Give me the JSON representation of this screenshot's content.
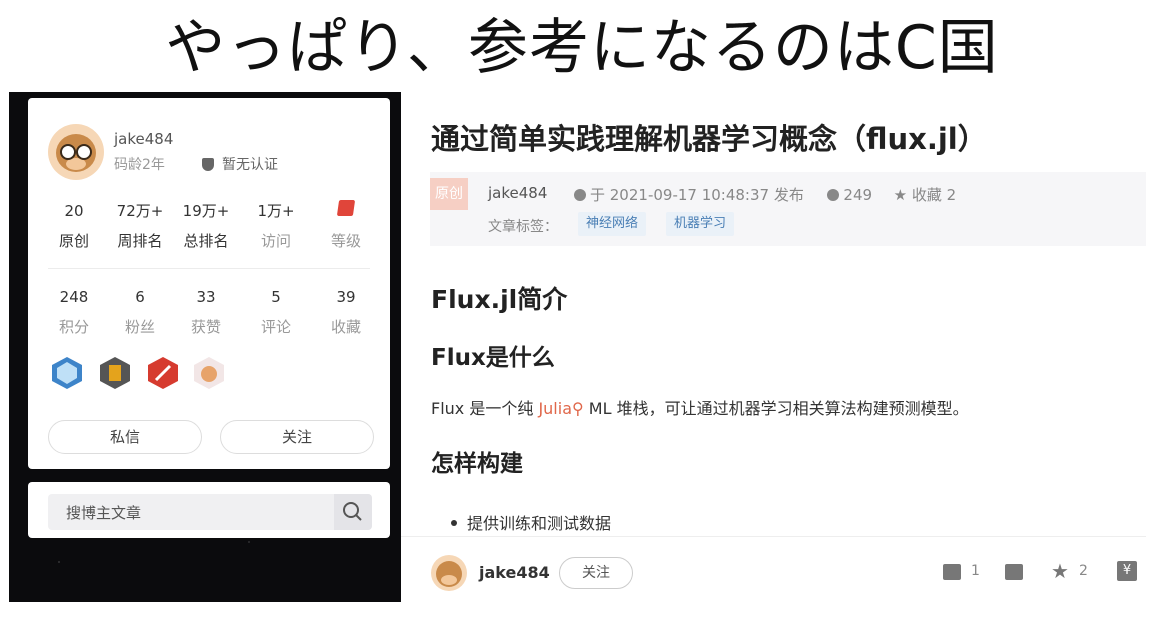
{
  "banner": {
    "text": "やっぱり、参考になるのはC国"
  },
  "profile": {
    "username": "jake484",
    "code_age": "码龄2年",
    "verification": "暂无认证",
    "stats_row1": [
      {
        "value": "20",
        "label": "原创"
      },
      {
        "value": "72万+",
        "label": "周排名"
      },
      {
        "value": "19万+",
        "label": "总排名"
      },
      {
        "value": "1万+",
        "label": "访问"
      },
      {
        "value": "",
        "label": "等级"
      }
    ],
    "stats_row2": [
      {
        "value": "248",
        "label": "积分"
      },
      {
        "value": "6",
        "label": "粉丝"
      },
      {
        "value": "33",
        "label": "获赞"
      },
      {
        "value": "5",
        "label": "评论"
      },
      {
        "value": "39",
        "label": "收藏"
      }
    ],
    "message_button": "私信",
    "follow_button": "关注"
  },
  "search": {
    "placeholder": "搜博主文章"
  },
  "article": {
    "title": "通过简单实践理解机器学习概念（flux.jl）",
    "original_badge": "原创",
    "author": "jake484",
    "published": "于 2021-09-17 10:48:37 发布",
    "views": "249",
    "favorites": "收藏 2",
    "tags_label": "文章标签：",
    "tags": [
      "神经网络",
      "机器学习"
    ],
    "h1": "Flux.jl简介",
    "h2": "Flux是什么",
    "para_before": "Flux 是一个纯 ",
    "para_link": "Julia",
    "para_after": " ML 堆栈，可让通过机器学习相关算法构建预测模型。",
    "h3": "怎样构建",
    "bullet": "提供训练和测试数据"
  },
  "bottom_bar": {
    "author": "jake484",
    "follow": "关注",
    "likes": "1",
    "stars": "2"
  },
  "colors": {
    "accent": "#e0674a",
    "tag_text": "#4a7fb5",
    "level_icon": "#e0453a"
  }
}
